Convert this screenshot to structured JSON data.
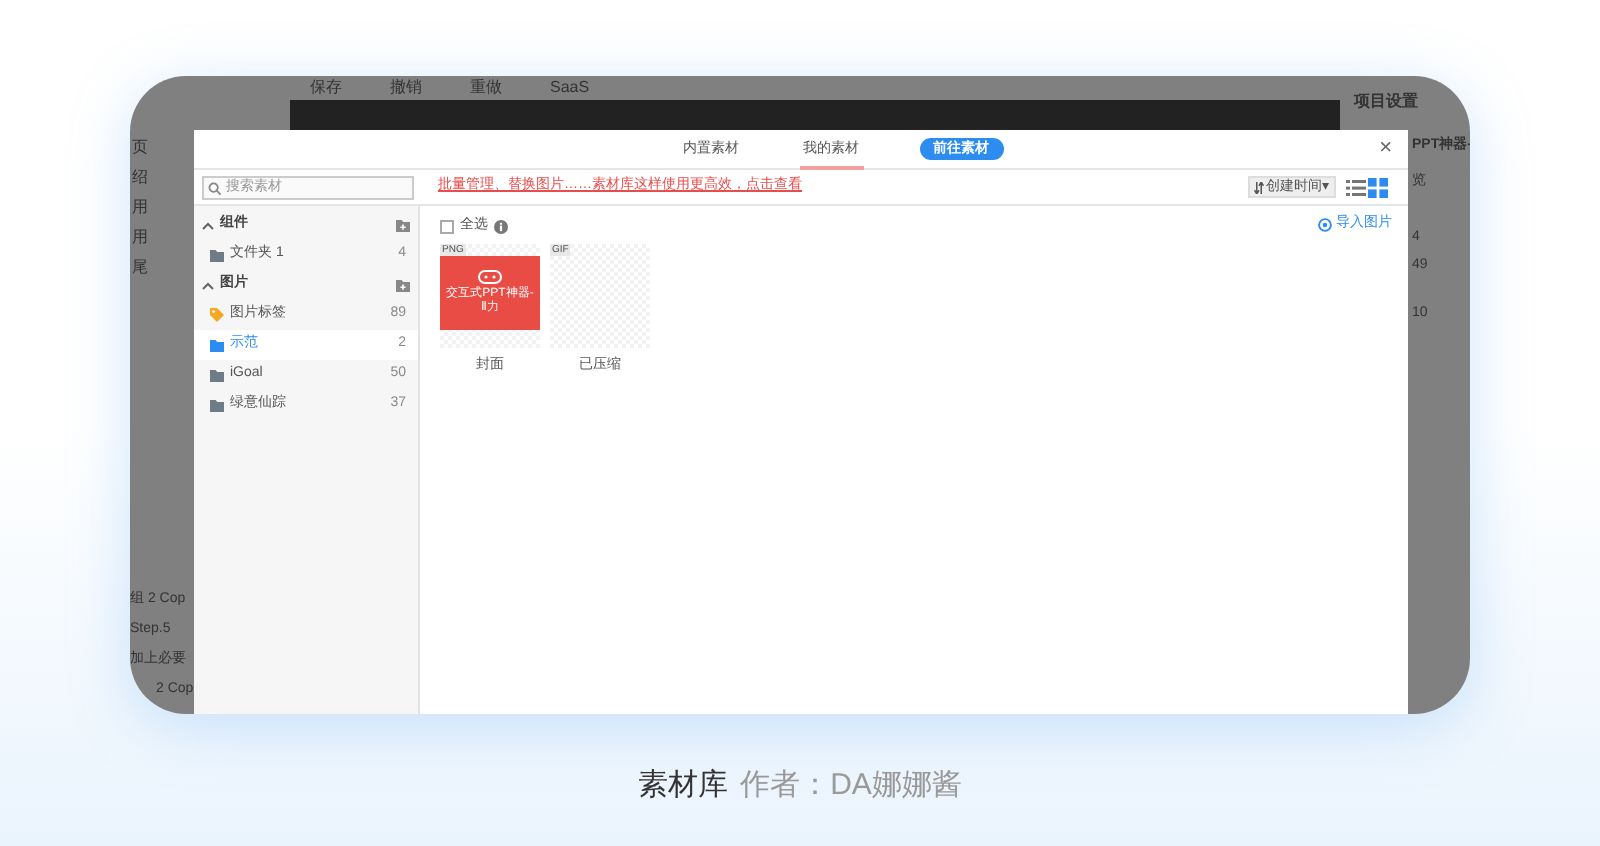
{
  "background_app": {
    "toolbar": [
      "保存",
      "撤销",
      "重做",
      "SaaS"
    ],
    "left_labels": [
      "页",
      "绍",
      "用",
      "用",
      "尾"
    ],
    "left_layers": [
      "组 2 Cop",
      "Step.5",
      "加上必要",
      "2 Cop"
    ],
    "right_panel": {
      "tab": "项目设置",
      "title": "PPT神器-",
      "dropdown": "览",
      "numbers": [
        "4",
        "49",
        "10"
      ]
    }
  },
  "dialog": {
    "tabs": [
      {
        "label": "内置素材",
        "selected": false,
        "kind": "tab"
      },
      {
        "label": "我的素材",
        "selected": true,
        "kind": "tab"
      },
      {
        "label": "前往素材",
        "selected": false,
        "kind": "pill"
      }
    ],
    "close": "×",
    "search": {
      "placeholder": "搜索素材"
    },
    "notice": "批量管理、替换图片……素材库这样使用更高效，点击查看",
    "sort": "创建时间",
    "sort_caret": "▾",
    "view_modes": [
      {
        "kind": "list",
        "selected": false
      },
      {
        "kind": "grid",
        "selected": true
      }
    ],
    "sidebar": [
      {
        "label": "组件",
        "kind": "group",
        "expanded": true,
        "children": [
          {
            "label": "文件夹 1",
            "kind": "folder",
            "count": "4",
            "selected": false
          }
        ]
      },
      {
        "label": "图片",
        "kind": "group",
        "expanded": true,
        "children": [
          {
            "label": "图片标签",
            "kind": "tag",
            "count": "89",
            "selected": false
          },
          {
            "label": "示范",
            "kind": "folder",
            "count": "2",
            "selected": true
          },
          {
            "label": "iGoal",
            "kind": "folder",
            "count": "50",
            "selected": false
          },
          {
            "label": "绿意仙踪",
            "kind": "folder",
            "count": "37",
            "selected": false
          }
        ]
      }
    ],
    "select_all": {
      "label": "全选",
      "checked": false
    },
    "import": "导入图片",
    "items": [
      {
        "format": "PNG",
        "name": "封面",
        "kind": "cover",
        "cover_text": "交互式PPT神器-Ⅱ力"
      },
      {
        "format": "GIF",
        "name": "已压缩",
        "kind": "blank"
      }
    ]
  },
  "caption": {
    "title": "素材库",
    "author": "作者：DA娜娜酱"
  }
}
